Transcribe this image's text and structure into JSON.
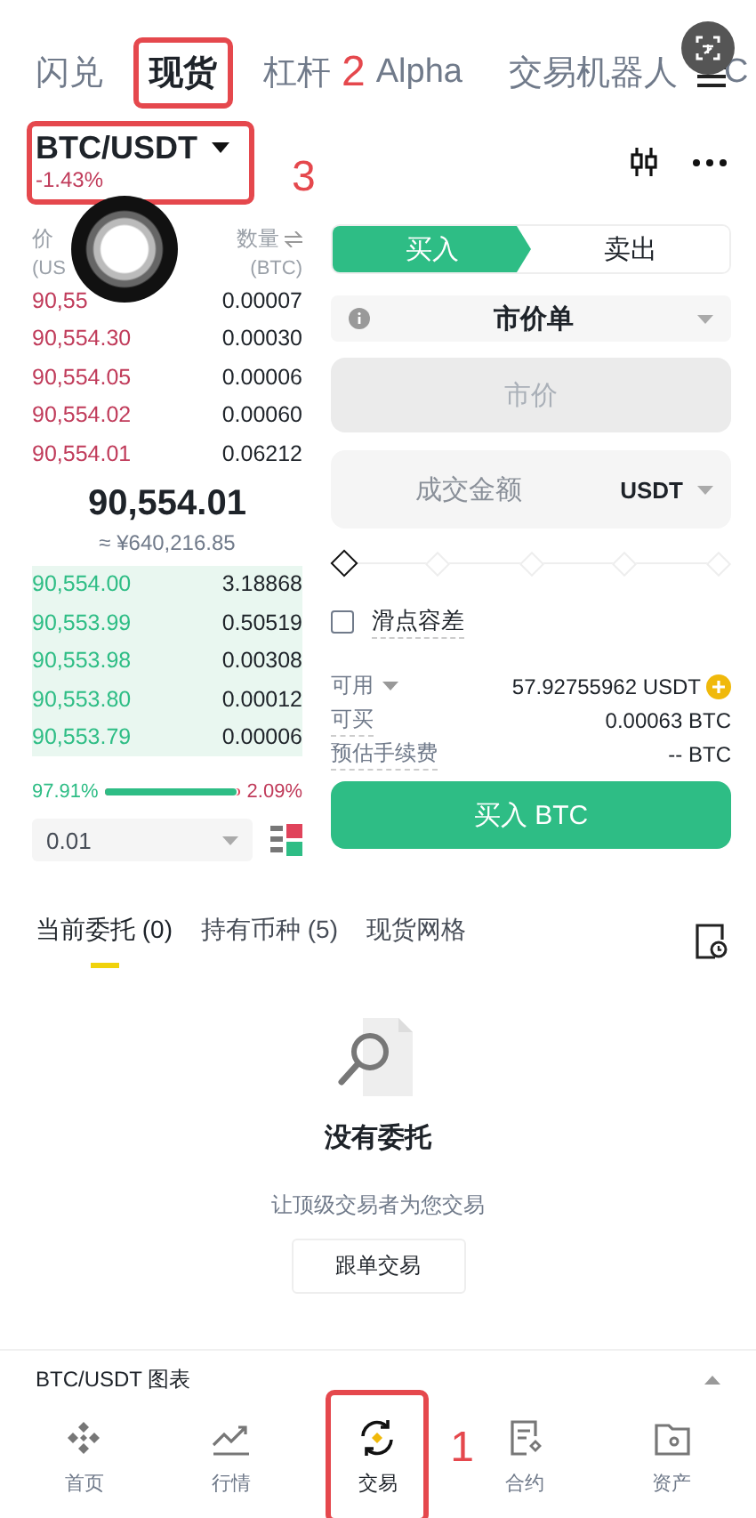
{
  "top_tabs": [
    {
      "label": "闪兑",
      "selected": false,
      "highlighted": false
    },
    {
      "label": "现货",
      "selected": true,
      "highlighted": true
    },
    {
      "label": "杠杆",
      "selected": false,
      "highlighted": false,
      "callout": "2"
    },
    {
      "label": "Alpha",
      "selected": false,
      "highlighted": false
    },
    {
      "label": "交易机器人",
      "selected": false,
      "highlighted": false
    },
    {
      "label": "C",
      "selected": false,
      "highlighted": false
    }
  ],
  "pair": {
    "symbol": "BTC/USDT",
    "change": "-1.43%",
    "highlighted": true,
    "callout": "3"
  },
  "order_book": {
    "price_header": "价",
    "price_unit": "(US",
    "amount_header": "数量",
    "amount_unit": "(BTC)",
    "asks": [
      {
        "price": "90,55",
        "amount": "0.00007"
      },
      {
        "price": "90,554.30",
        "amount": "0.00030"
      },
      {
        "price": "90,554.05",
        "amount": "0.00006"
      },
      {
        "price": "90,554.02",
        "amount": "0.00060"
      },
      {
        "price": "90,554.01",
        "amount": "0.06212"
      }
    ],
    "last_price": "90,554.01",
    "fiat_price": "≈ ¥640,216.85",
    "bids": [
      {
        "price": "90,554.00",
        "amount": "3.18868"
      },
      {
        "price": "90,553.99",
        "amount": "0.50519"
      },
      {
        "price": "90,553.98",
        "amount": "0.00308"
      },
      {
        "price": "90,553.80",
        "amount": "0.00012"
      },
      {
        "price": "90,553.79",
        "amount": "0.00006"
      }
    ],
    "buy_ratio": "97.91%",
    "sell_ratio": "2.09%",
    "level": 0.9791,
    "precision": "0.01"
  },
  "order_form": {
    "sides": [
      {
        "label": "买入",
        "selected": true
      },
      {
        "label": "卖出",
        "selected": false
      }
    ],
    "order_type": "市价单",
    "price_placeholder": "市价",
    "amount_placeholder": "成交金额",
    "amount_unit": "USDT",
    "slider": {
      "level": 0
    },
    "slippage": {
      "label": "滑点容差",
      "checked": false
    },
    "info": [
      {
        "label": "可用",
        "value": "57.92755962 USDT",
        "kind": "available"
      },
      {
        "label": "可买",
        "value": "0.00063 BTC",
        "kind": "plain"
      },
      {
        "label": "预估手续费",
        "value": "-- BTC",
        "kind": "plain"
      }
    ],
    "submit": "买入 BTC"
  },
  "orders_tabs": [
    {
      "label": "当前委托 (0)",
      "selected": true
    },
    {
      "label": "持有币种 (5)",
      "selected": false
    },
    {
      "label": "现货网格",
      "selected": false
    }
  ],
  "empty_state": {
    "title": "没有委托",
    "subtitle": "让顶级交易者为您交易",
    "button": "跟单交易"
  },
  "chart_bar": {
    "label": "BTC/USDT 图表"
  },
  "bottom_nav": [
    {
      "label": "首页",
      "kind": "home",
      "selected": false,
      "highlighted": false
    },
    {
      "label": "行情",
      "kind": "markets",
      "selected": false,
      "highlighted": false
    },
    {
      "label": "交易",
      "kind": "trade",
      "selected": true,
      "highlighted": true,
      "callout": "1"
    },
    {
      "label": "合约",
      "kind": "futures",
      "selected": false,
      "highlighted": false
    },
    {
      "label": "资产",
      "kind": "assets",
      "selected": false,
      "highlighted": false
    }
  ]
}
